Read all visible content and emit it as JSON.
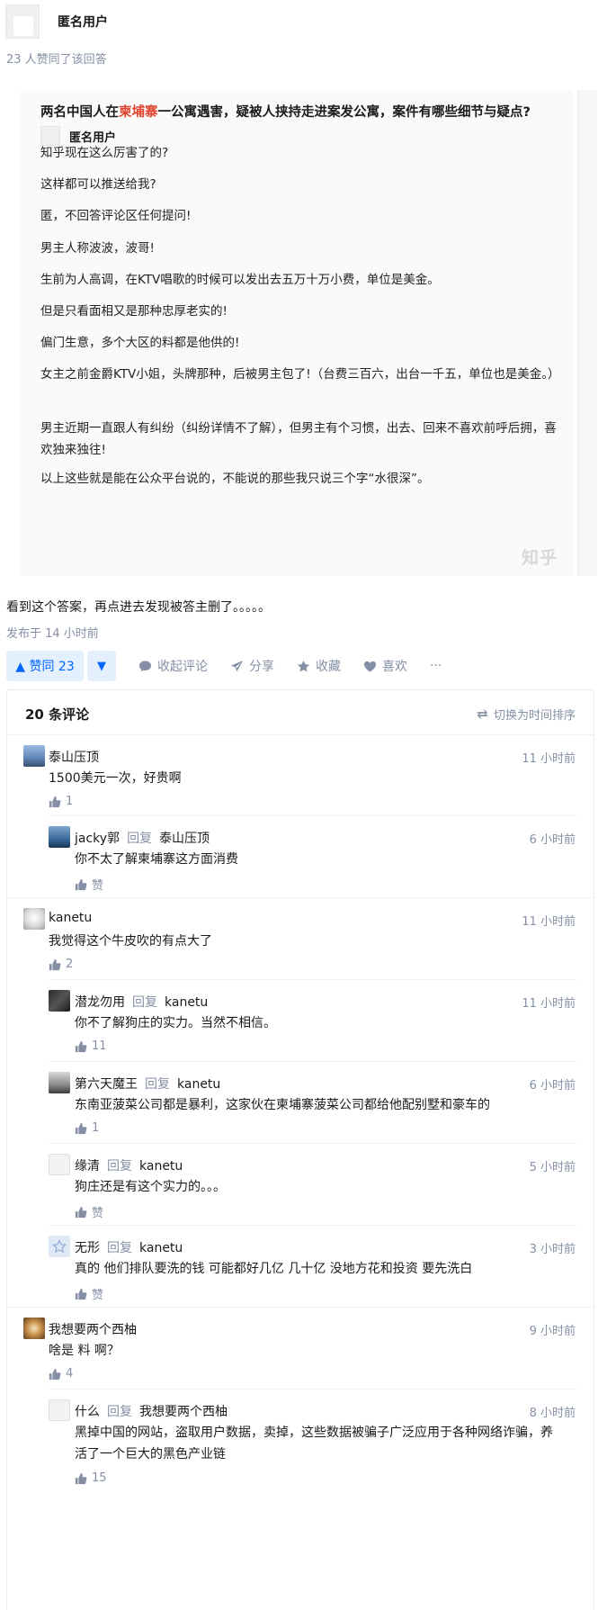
{
  "answer": {
    "author_name": "匿名用户",
    "vote_info": "23 人赞同了该回答",
    "body_text": "看到这个答案，再点进去发现被答主删了。。。。。",
    "published": "发布于 14 小时前"
  },
  "quote": {
    "title_before": "两名中国人在",
    "title_highlight": "柬埔寨",
    "title_after": "一公寓遇害，疑被人挟持走进案发公寓，案件有哪些细节与疑点?",
    "author_name": "匿名用户",
    "paragraphs": [
      "知乎现在这么厉害了的?",
      "这样都可以推送给我?",
      "匿，不回答评论区任何提问!",
      "男主人称波波，波哥!",
      "生前为人高调，在KTV唱歌的时候可以发出去五万十万小费，单位是美金。",
      "但是只看面相又是那种忠厚老实的!",
      "偏门生意，多个大区的料都是他供的!",
      "女主之前金爵KTV小姐，头牌那种，后被男主包了!（台费三百六，出台一千五，单位也是美金。）",
      "男主近期一直跟人有纠纷（纠纷详情不了解），但男主有个习惯，出去、回来不喜欢前呼后拥，喜欢独来独往!",
      "以上这些就是能在公众平台说的，不能说的那些我只说三个字“水很深”。"
    ],
    "watermark": "知乎"
  },
  "actions": {
    "vote_label": "▲ 赞同 23",
    "downvote": "▼",
    "comment": "收起评论",
    "share": "分享",
    "collect": "收藏",
    "like": "喜欢",
    "more": "···"
  },
  "comments_panel": {
    "count_label": "20 条评论",
    "sort_label": "切换为时间排序",
    "items": [
      {
        "user": "泰山压顶",
        "reply_to": "",
        "time": "11 小时前",
        "text": "1500美元一次，好贵啊",
        "likes": "1"
      },
      {
        "user": "jacky郭",
        "reply_word": "回复",
        "reply_to": "泰山压顶",
        "time": "6 小时前",
        "text": "你不太了解柬埔寨这方面消费",
        "likes": "赞"
      },
      {
        "user": "kanetu",
        "reply_to": "",
        "time": "11 小时前",
        "text": "我觉得这个牛皮吹的有点大了",
        "likes": "2"
      },
      {
        "user": "潜龙勿用",
        "reply_word": "回复",
        "reply_to": "kanetu",
        "time": "11 小时前",
        "text": "你不了解狗庄的实力。当然不相信。",
        "likes": "11"
      },
      {
        "user": "第六天魔王",
        "reply_word": "回复",
        "reply_to": "kanetu",
        "time": "6 小时前",
        "text": "东南亚菠菜公司都是暴利，这家伙在柬埔寨菠菜公司都给他配别墅和豪车的",
        "likes": "1"
      },
      {
        "user": "缘清",
        "reply_word": "回复",
        "reply_to": "kanetu",
        "time": "5 小时前",
        "text": "狗庄还是有这个实力的。。。",
        "likes": "赞"
      },
      {
        "user": "无形",
        "reply_word": "回复",
        "reply_to": "kanetu",
        "time": "3 小时前",
        "text": "真的 他们排队要洗的钱 可能都好几亿 几十亿 没地方花和投资 要先洗白",
        "likes": "赞"
      },
      {
        "user": "我想要两个西柚",
        "reply_to": "",
        "time": "9 小时前",
        "text": "啥是 料 啊？",
        "likes": "4"
      },
      {
        "user": "什么",
        "reply_word": "回复",
        "reply_to": "我想要两个西柚",
        "time": "8 小时前",
        "text": "黑掉中国的网站，盗取用户数据，卖掉，这些数据被骗子广泛应用于各种网络诈骗，养活了一个巨大的黑色产业链",
        "likes": "15"
      }
    ]
  },
  "colors": {
    "accent": "#0066ff",
    "accent_bg": "#e5f0ff",
    "muted": "#8590a6",
    "highlight": "#e0442e"
  }
}
